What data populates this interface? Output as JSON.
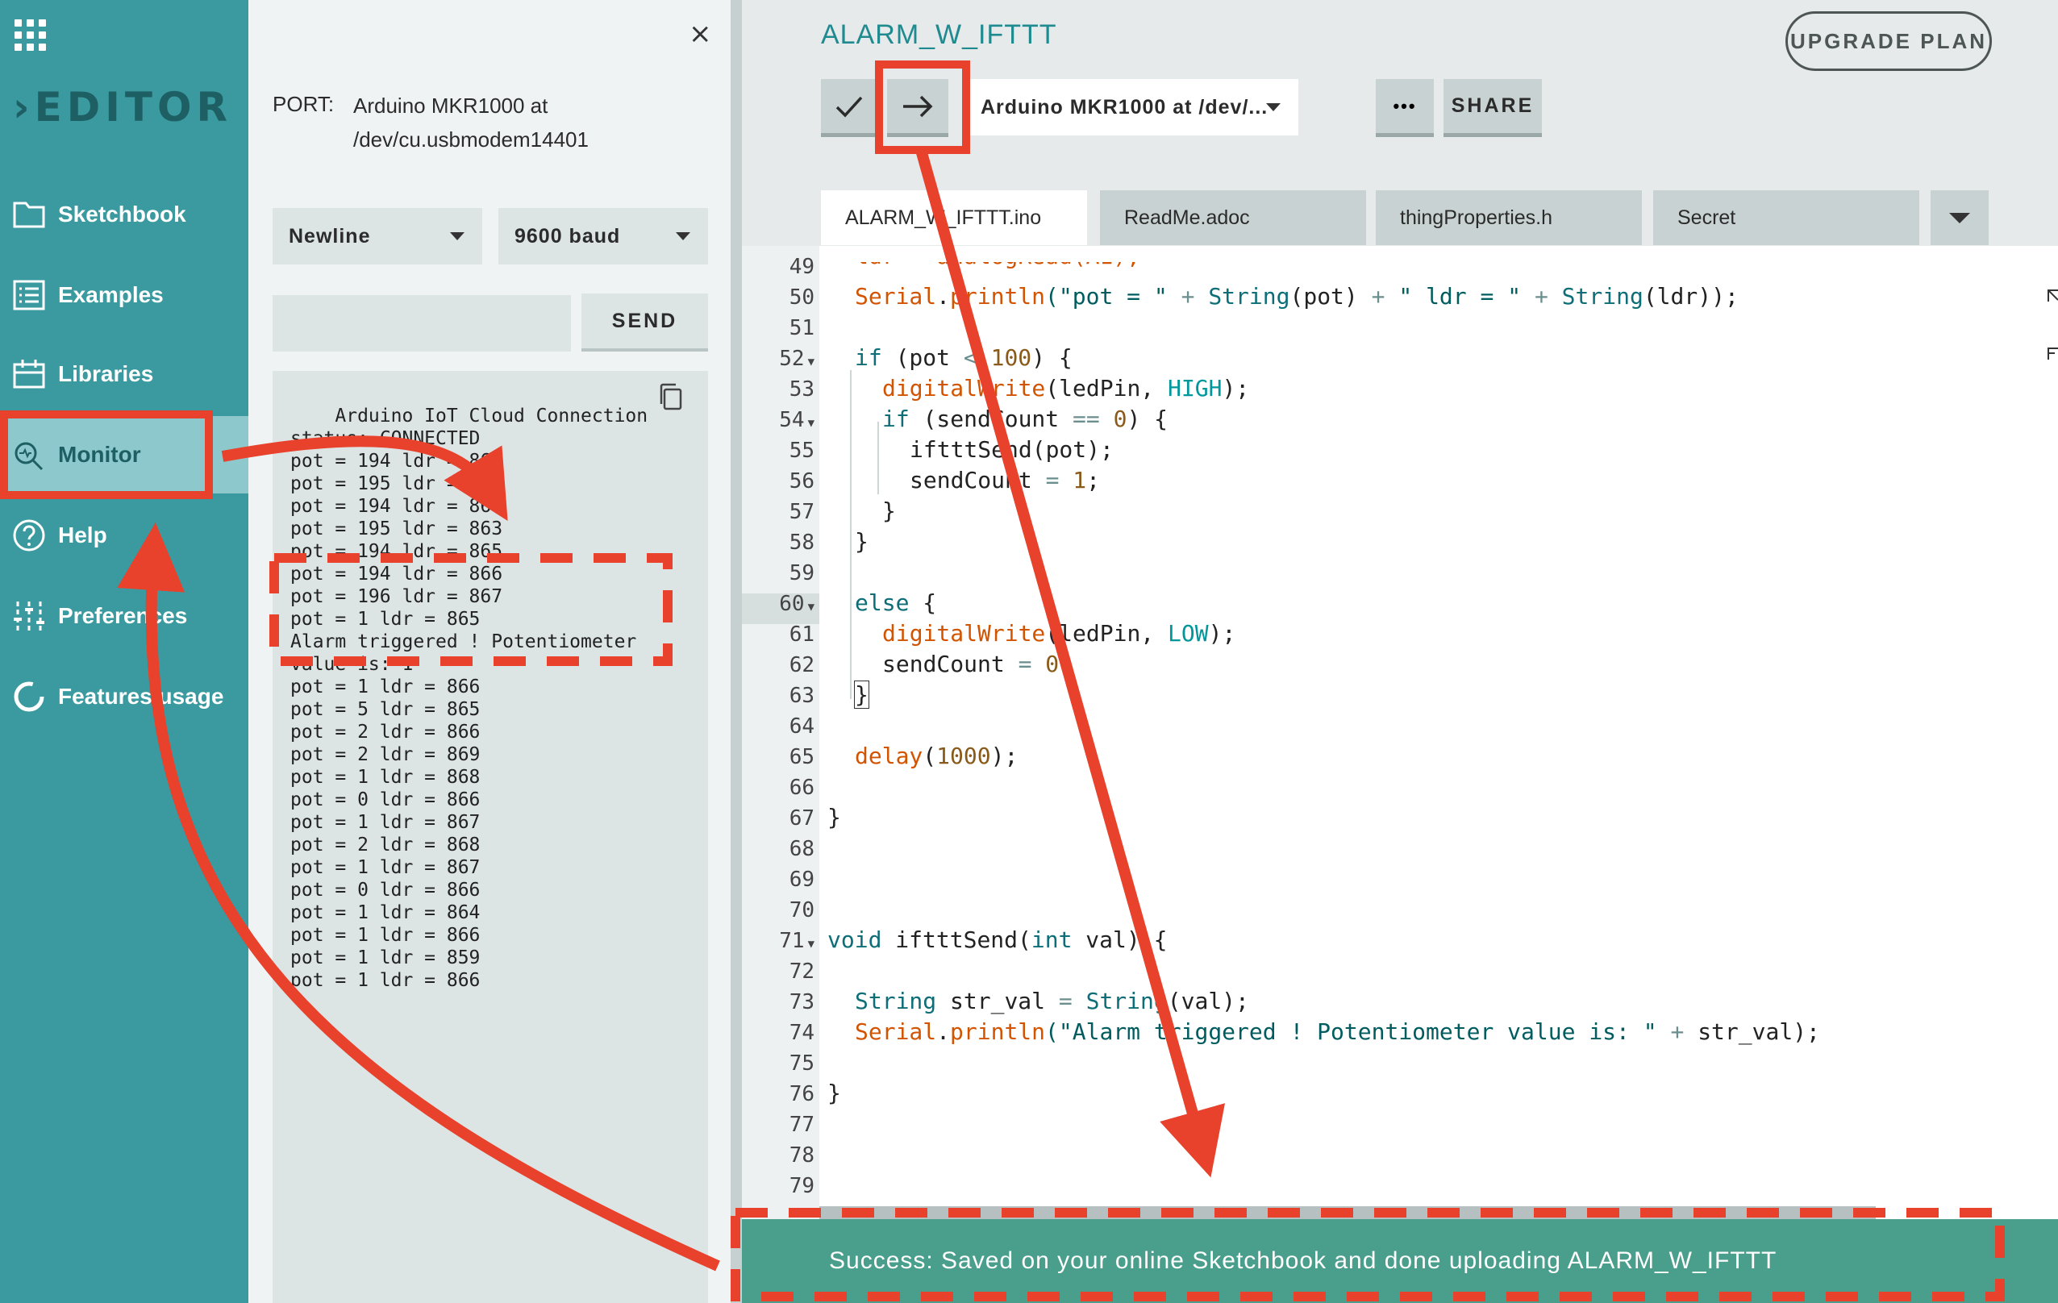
{
  "nav": {
    "logo": "EDITOR",
    "items": [
      {
        "label": "Sketchbook"
      },
      {
        "label": "Examples"
      },
      {
        "label": "Libraries"
      },
      {
        "label": "Monitor"
      },
      {
        "label": "Help"
      },
      {
        "label": "Preferences"
      },
      {
        "label": "Features usage"
      }
    ]
  },
  "monitor": {
    "port_label": "PORT:",
    "port_value": "Arduino MKR1000 at /dev/cu.usbmodem14401",
    "line_ending": "Newline",
    "baud": "9600 baud",
    "send_label": "SEND",
    "log": "Arduino IoT Cloud Connection\nstatus: CONNECTED\npot = 194 ldr = 866\npot = 195 ldr = 867\npot = 194 ldr = 866\npot = 195 ldr = 863\npot = 194 ldr = 865\npot = 194 ldr = 866\npot = 196 ldr = 867\npot = 1 ldr = 865\nAlarm triggered ! Potentiometer\nvalue is: 1\npot = 1 ldr = 866\npot = 5 ldr = 865\npot = 2 ldr = 866\npot = 2 ldr = 869\npot = 1 ldr = 868\npot = 0 ldr = 866\npot = 1 ldr = 867\npot = 2 ldr = 868\npot = 1 ldr = 867\npot = 0 ldr = 866\npot = 1 ldr = 864\npot = 1 ldr = 866\npot = 1 ldr = 859\npot = 1 ldr = 866"
  },
  "editor": {
    "sketch_name": "ALARM_W_IFTTT",
    "upgrade_label": "UPGRADE PLAN",
    "board": "Arduino MKR1000 at /dev/...",
    "more_label": "•••",
    "share_label": "SHARE",
    "tabs": [
      {
        "label": "ALARM_W_IFTTT.ino"
      },
      {
        "label": "ReadMe.adoc"
      },
      {
        "label": "thingProperties.h"
      },
      {
        "label": "Secret"
      }
    ],
    "line_numbers": [
      "49",
      "50",
      "51",
      "52",
      "53",
      "54",
      "55",
      "56",
      "57",
      "58",
      "59",
      "60",
      "61",
      "62",
      "63",
      "64",
      "65",
      "66",
      "67",
      "68",
      "69",
      "70",
      "71",
      "72",
      "73",
      "74",
      "75",
      "76",
      "77",
      "78",
      "79"
    ],
    "code": {
      "l50": [
        "Serial",
        ".",
        "println",
        "(\"pot = \" ",
        "+",
        " ",
        "String",
        "(pot) ",
        "+",
        " \" ldr = \" ",
        "+",
        " ",
        "String",
        "(ldr));"
      ],
      "l52": [
        "if",
        " (pot ",
        "<",
        " ",
        "100",
        ") {"
      ],
      "l53": [
        "digitalWrite",
        "(ledPin, ",
        "HIGH",
        ");"
      ],
      "l54": [
        "if",
        " (sendCount ",
        "==",
        " ",
        "0",
        ") {"
      ],
      "l55": "iftttSend(pot);",
      "l56": [
        "sendCount ",
        "=",
        " ",
        "1",
        ";"
      ],
      "l57": "}",
      "l58": "}",
      "l60": [
        "else",
        " {"
      ],
      "l61": [
        "digitalWrite",
        "(ledPin, ",
        "LOW",
        ");"
      ],
      "l62": [
        "sendCount ",
        "=",
        " ",
        "0",
        ";"
      ],
      "l63": "}",
      "l65": [
        "delay",
        "(",
        "1000",
        ");"
      ],
      "l67": "}",
      "l71": [
        "void",
        " iftttSend(",
        "int",
        " val) {"
      ],
      "l73": [
        "String",
        " str_val ",
        "=",
        " ",
        "String",
        "(val);"
      ],
      "l74": [
        "Serial",
        ".",
        "println",
        "(\"Alarm triggered ! Potentiometer value is: \" ",
        "+",
        " str_val);"
      ],
      "l76": "}"
    },
    "status": "Success: Saved on your online Sketchbook and done uploading ALARM_W_IFTTT"
  },
  "colors": {
    "nav_bg": "#3a9aa0",
    "nav_active": "#8dc9cc",
    "annotation_red": "#e8412c",
    "status_bg": "#4a9e8c"
  }
}
